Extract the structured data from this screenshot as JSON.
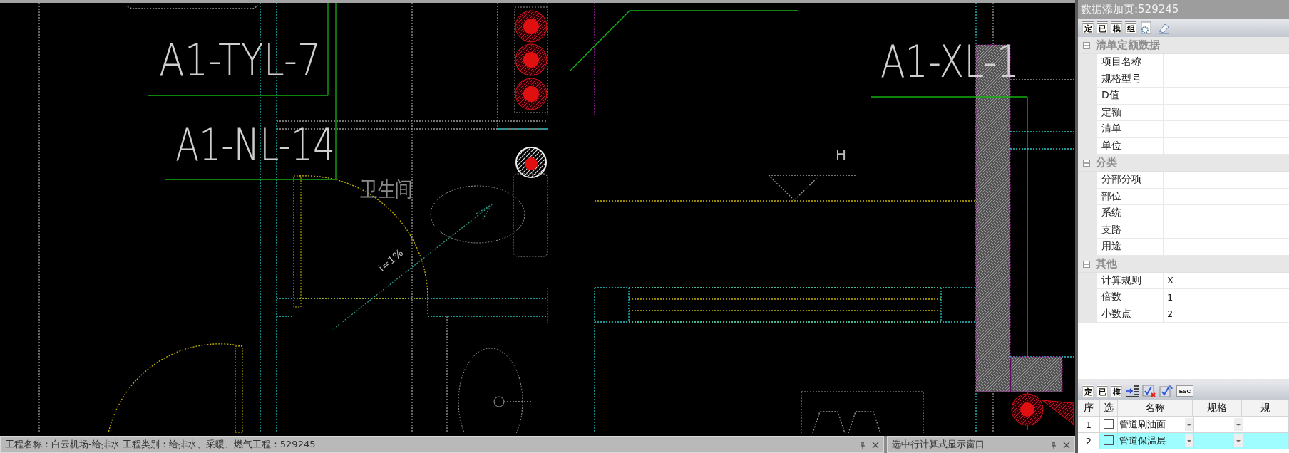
{
  "drawing": {
    "labels": [
      {
        "kind": "tag",
        "text": "A1-TYL-7"
      },
      {
        "kind": "tag",
        "text": "A1-NL-14"
      },
      {
        "kind": "room",
        "text": "卫生间"
      },
      {
        "kind": "slope",
        "text": "i=1%"
      },
      {
        "kind": "mark",
        "text": "H"
      },
      {
        "kind": "tag",
        "text": "A1-XL-1"
      }
    ]
  },
  "status_panels": [
    {
      "title": "工程名称：白云机场-给排水  工程类别：给排水、采暖、燃气工程：529245"
    },
    {
      "title": "选中行计算式显示窗口"
    }
  ],
  "panel": {
    "title": "数据添加页:529245",
    "toolbar": [
      {
        "kind": "char",
        "label": "定"
      },
      {
        "kind": "char",
        "label": "已"
      },
      {
        "kind": "char",
        "label": "模"
      },
      {
        "kind": "char",
        "label": "组"
      },
      {
        "kind": "gear-doc"
      },
      {
        "kind": "eraser"
      }
    ],
    "sections": [
      {
        "title": "清单定额数据",
        "expanded": true,
        "rows": [
          {
            "label": "项目名称"
          },
          {
            "label": "规格型号"
          },
          {
            "label": "D值"
          },
          {
            "label": "定额"
          },
          {
            "label": "清单"
          },
          {
            "label": "单位"
          }
        ]
      },
      {
        "title": "分类",
        "expanded": true,
        "rows": [
          {
            "label": "分部分项"
          },
          {
            "label": "部位"
          },
          {
            "label": "系统"
          },
          {
            "label": "支路"
          },
          {
            "label": "用途"
          }
        ]
      },
      {
        "title": "其他",
        "expanded": true,
        "rows": [
          {
            "label": "计算规则",
            "value": "X"
          },
          {
            "label": "倍数",
            "value": "1"
          },
          {
            "label": "小数点",
            "value": "2"
          }
        ]
      }
    ]
  },
  "list": {
    "toolbar": [
      {
        "kind": "char",
        "label": "定"
      },
      {
        "kind": "char",
        "label": "已"
      },
      {
        "kind": "char",
        "label": "模"
      },
      {
        "kind": "indent"
      },
      {
        "kind": "check-x"
      },
      {
        "kind": "check-refresh"
      },
      {
        "kind": "key",
        "label": "ESC"
      }
    ],
    "columns": [
      "序",
      "选",
      "名称",
      "规格",
      "规"
    ],
    "rows": [
      {
        "index": "1",
        "checked": false,
        "selected": false,
        "name": "管道刷油面"
      },
      {
        "index": "2",
        "checked": false,
        "selected": true,
        "name": "管道保温层"
      }
    ]
  }
}
